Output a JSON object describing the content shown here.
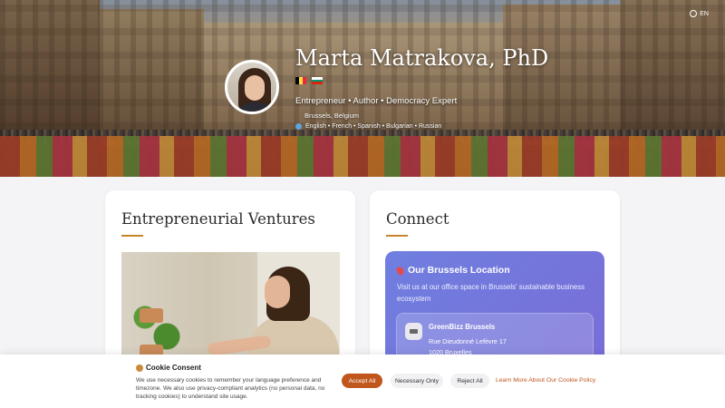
{
  "header": {
    "language_label": "EN",
    "name": "Marta Matrakova, PhD",
    "flags": [
      "belgium-flag",
      "bulgaria-flag"
    ],
    "tagline": "Entrepreneur • Author • Democracy Expert",
    "location": "Brussels, Belgium",
    "languages": "English • French • Spanish • Bulgarian • Russian"
  },
  "ventures": {
    "title": "Entrepreneurial Ventures"
  },
  "connect": {
    "title": "Connect",
    "location_title": "Our Brussels Location",
    "location_description": "Visit us at our office space in Brussels' sustainable business ecosystem",
    "venue_name": "GreenBizz Brussels",
    "venue_address_line1": "Rue Dieudonné Lefèvre 17",
    "venue_address_line2": "1020 Bruxelles"
  },
  "cookie": {
    "title": "Cookie Consent",
    "text": "We use necessary cookies to remember your language preference and timezone. We also use privacy-compliant analytics (no personal data, no tracking cookies) to understand site usage.",
    "accept_label": "Accept All",
    "necessary_label": "Necessary Only",
    "reject_label": "Reject All",
    "learn_more_label": "Learn More About Our Cookie Policy"
  },
  "colors": {
    "accent": "#c8832c",
    "accept_button": "#c0561c",
    "location_card": "#7a6bd6"
  }
}
